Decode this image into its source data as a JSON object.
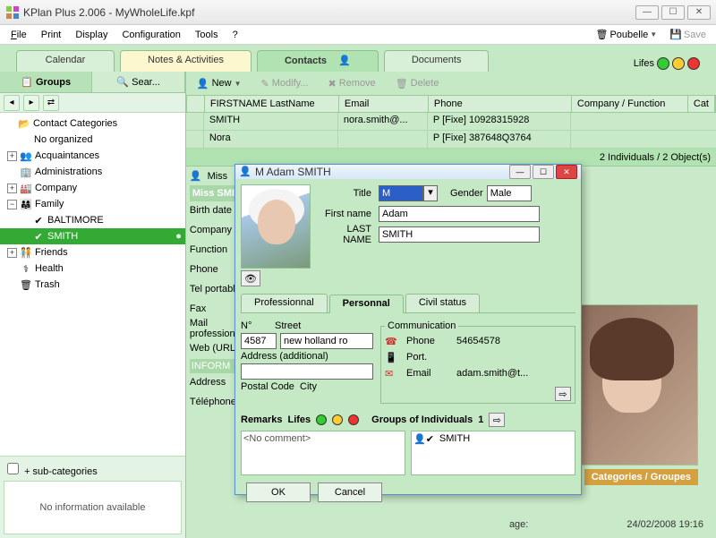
{
  "window": {
    "title": "KPlan Plus 2.006 - MyWholeLife.kpf"
  },
  "menu": {
    "file": "File",
    "print": "Print",
    "display": "Display",
    "config": "Configuration",
    "tools": "Tools",
    "help": "?",
    "poubelle": "Poubelle",
    "save": "Save"
  },
  "tabs": {
    "calendar": "Calendar",
    "notes": "Notes & Activities",
    "contacts": "Contacts",
    "documents": "Documents",
    "lifes": "Lifes"
  },
  "sidetabs": {
    "groups": "Groups",
    "search": "Sear..."
  },
  "tree": {
    "root": "Contact Categories",
    "noorg": "No organized",
    "acq": "Acquaintances",
    "admin": "Administrations",
    "company": "Company",
    "family": "Family",
    "baltimore": "BALTIMORE",
    "smith": "SMITH",
    "friends": "Friends",
    "health": "Health",
    "trash": "Trash"
  },
  "sidefoot": {
    "subcat": "+ sub-categories",
    "noinfo": "No information available"
  },
  "maintool": {
    "new": "New",
    "modify": "Modify...",
    "remove": "Remove",
    "delete": "Delete"
  },
  "grid": {
    "headers": [
      "FIRSTNAME LastName",
      "Email",
      "Phone",
      "Company / Function",
      "Cat"
    ],
    "rows": [
      {
        "name": "SMITH",
        "email": "nora.smith@...",
        "phone": "P [Fixe] 10928315928"
      },
      {
        "name": "Nora",
        "email": "",
        "phone": "P [Fixe] 387648Q3764"
      }
    ],
    "status": "2 Individuals / 2 Object(s)"
  },
  "detail": {
    "miss": "Miss",
    "misssmith": "Miss SMITH",
    "birth": "Birth date",
    "company": "Company",
    "function": "Function",
    "phone": "Phone",
    "telport": "Tel portable",
    "fax": "Fax",
    "mailpro": "Mail professional",
    "web": "Web (URL)",
    "inform": "INFORM",
    "address": "Address",
    "tele": "Téléphone",
    "cat": "Categories / Groupes",
    "age": "age:"
  },
  "dialog": {
    "title": "M Adam SMITH",
    "title_lbl": "Title",
    "title_val": "M",
    "gender_lbl": "Gender",
    "gender_val": "Male",
    "first_lbl": "First name",
    "first_val": "Adam",
    "last_lbl": "LAST NAME",
    "last_val": "SMITH",
    "tab_pro": "Professionnal",
    "tab_per": "Personnal",
    "tab_civ": "Civil status",
    "n_lbl": "N°",
    "n_val": "4587",
    "street_lbl": "Street",
    "street_val": "new holland ro",
    "addr2_lbl": "Address (additional)",
    "addr2_val": "",
    "postal_lbl": "Postal Code",
    "city_lbl": "City",
    "comm_lbl": "Communication",
    "phone_lbl": "Phone",
    "phone_val": "54654578",
    "port_lbl": "Port.",
    "port_val": "",
    "email_lbl": "Email",
    "email_val": "adam.smith@t...",
    "remarks_lbl": "Remarks",
    "lifes_lbl": "Lifes",
    "nocomment": "<No comment>",
    "groups_lbl": "Groups of Individuals",
    "groups_count": "1",
    "groups_item": "SMITH",
    "ok": "OK",
    "cancel": "Cancel"
  },
  "footer": {
    "datetime": "24/02/2008 19:16"
  }
}
